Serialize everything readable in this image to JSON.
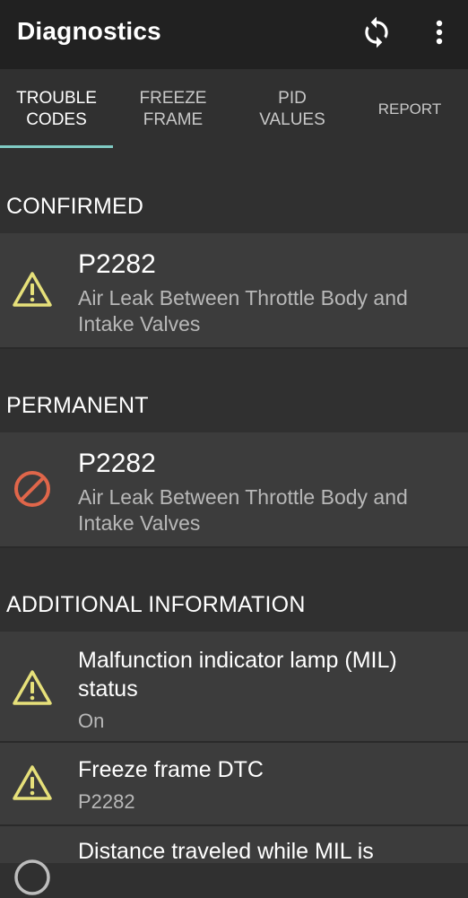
{
  "appbar": {
    "title": "Diagnostics",
    "actions": {
      "refresh_icon": "refresh-icon",
      "more_icon": "more-vert-icon"
    }
  },
  "tabs": [
    {
      "label_line1": "TROUBLE",
      "label_line2": "CODES",
      "active": true
    },
    {
      "label_line1": "FREEZE",
      "label_line2": "FRAME",
      "active": false
    },
    {
      "label_line1": "PID",
      "label_line2": "VALUES",
      "active": false
    },
    {
      "label_line1": "REPORT",
      "label_line2": "",
      "active": false
    }
  ],
  "sections": {
    "confirmed": {
      "header": "CONFIRMED",
      "items": [
        {
          "code": "P2282",
          "description": "Air Leak Between Throttle Body and Intake Valves",
          "icon": "warning-icon"
        }
      ]
    },
    "permanent": {
      "header": "PERMANENT",
      "items": [
        {
          "code": "P2282",
          "description": "Air Leak Between Throttle Body and Intake Valves",
          "icon": "blocked-icon"
        }
      ]
    },
    "additional": {
      "header": "ADDITIONAL INFORMATION",
      "items": [
        {
          "label": "Malfunction indicator lamp (MIL) status",
          "value": "On",
          "icon": "warning-icon"
        },
        {
          "label": "Freeze frame DTC",
          "value": "P2282",
          "icon": "warning-icon"
        },
        {
          "label": "Distance traveled while MIL is",
          "value": "",
          "icon": "info-icon"
        }
      ]
    }
  },
  "colors": {
    "appbar": "#212121",
    "background": "#303030",
    "card": "#3c3c3c",
    "tab_indicator": "#80cbc4",
    "warning": "#e6e07a",
    "blocked": "#e0664a"
  }
}
